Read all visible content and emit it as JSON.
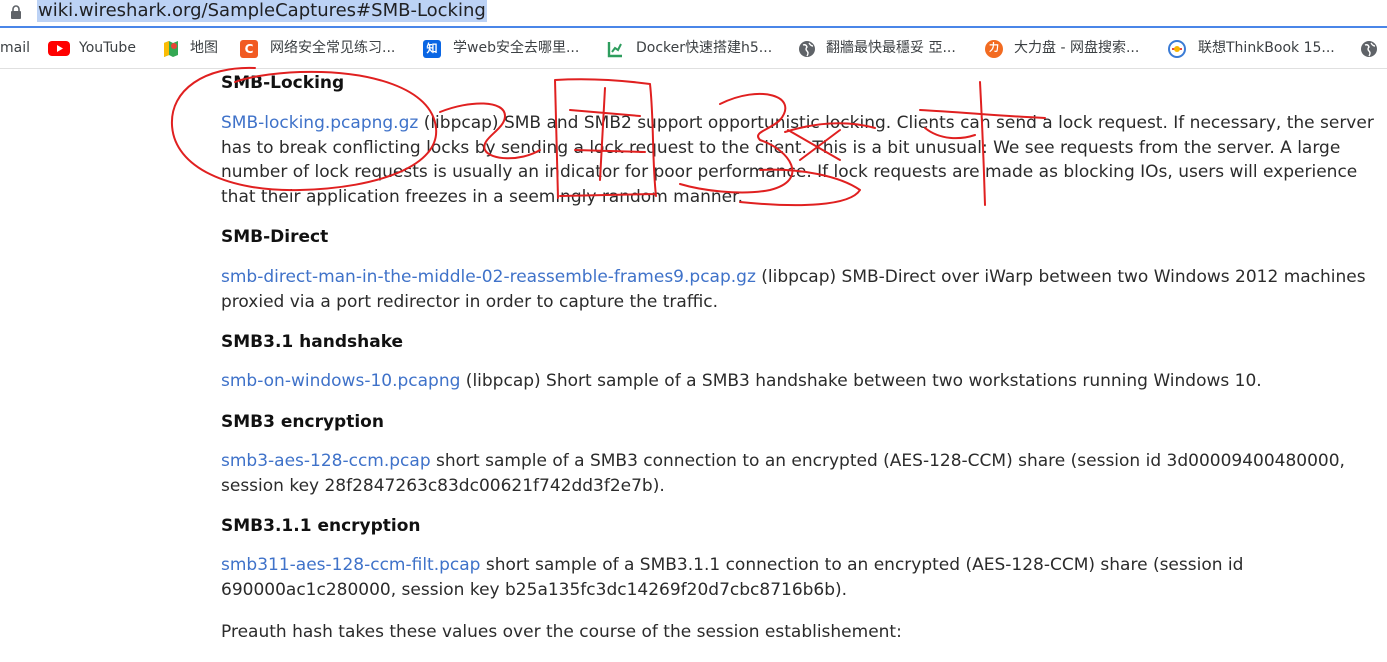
{
  "browser": {
    "url": "wiki.wireshark.org/SampleCaptures#SMB-Locking"
  },
  "bookmarks": [
    {
      "label": "mail",
      "icon": "none"
    },
    {
      "label": "YouTube",
      "icon": "youtube-icon"
    },
    {
      "label": "地图",
      "icon": "maps-icon"
    },
    {
      "label": "网络安全常见练习...",
      "icon": "c-site-icon"
    },
    {
      "label": "学web安全去哪里...",
      "icon": "zhihu-icon"
    },
    {
      "label": "Docker快速搭建h5...",
      "icon": "chart-site-icon"
    },
    {
      "label": "翻牆最快最穩妥 亞...",
      "icon": "globe-icon"
    },
    {
      "label": "大力盘 - 网盘搜索...",
      "icon": "dalipan-icon"
    },
    {
      "label": "联想ThinkBook 15...",
      "icon": "lenovo-icon"
    },
    {
      "label": "",
      "icon": "globe-icon"
    }
  ],
  "sections": [
    {
      "heading": "SMB-Locking",
      "link": "SMB-locking.pcapng.gz",
      "text": " (libpcap) SMB and SMB2 support opportunistic locking. Clients can send a lock request. If necessary, the server has to break conflicting locks by sending a lock request to the client. This is a bit unusual: We see requests from the server. A large number of lock requests is usually an indicator for poor performance. If lock requests are made as blocking IOs, users will experience that their application freezes in a seemingly random manner."
    },
    {
      "heading": "SMB-Direct",
      "link": "smb-direct-man-in-the-middle-02-reassemble-frames9.pcap.gz",
      "text": " (libpcap) SMB-Direct over iWarp between two Windows 2012 machines proxied via a port redirector in order to capture the traffic."
    },
    {
      "heading": "SMB3.1 handshake",
      "link": "smb-on-windows-10.pcapng",
      "text": " (libpcap) Short sample of a SMB3 handshake between two workstations running Windows 10."
    },
    {
      "heading": "SMB3 encryption",
      "link": "smb3-aes-128-ccm.pcap",
      "text": " short sample of a SMB3 connection to an encrypted (AES-128-CCM) share (session id 3d00009400480000, session key 28f2847263c83dc00621f742dd3f2e7b)."
    },
    {
      "heading": "SMB3.1.1 encryption",
      "link": "smb311-aes-128-ccm-filt.pcap",
      "text": " short sample of a SMB3.1.1 connection to an encrypted (AES-128-CCM) share (session id 690000ac1c280000, session key b25a135fc3dc14269f20d7cbc8716b6b)."
    }
  ],
  "footer_text": "Preauth hash takes these values over the course of the session establishement:",
  "colors": {
    "link": "#3f72c9",
    "annotation": "#e02020",
    "address_highlight": "#bcd2f5"
  }
}
